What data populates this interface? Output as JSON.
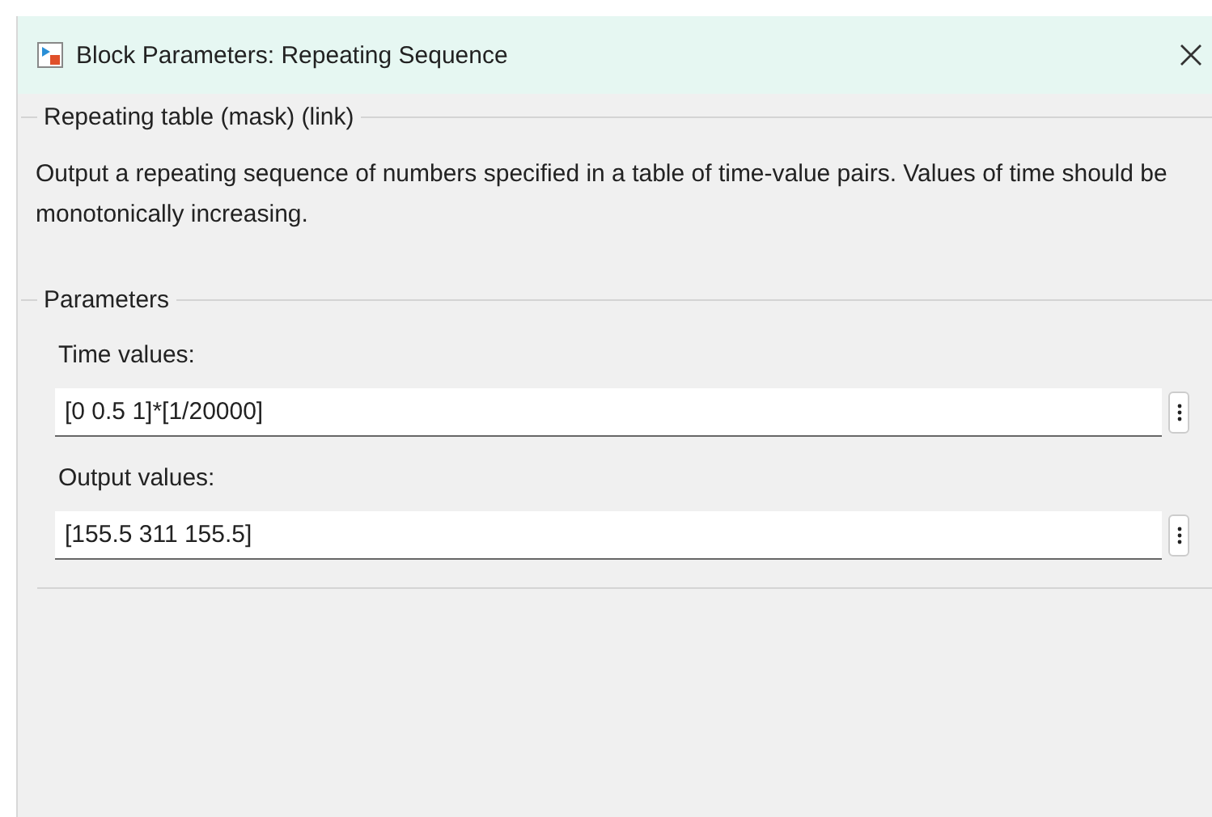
{
  "window": {
    "title": "Block Parameters: Repeating Sequence"
  },
  "description_group": {
    "title": "Repeating table (mask) (link)",
    "text": "Output a repeating sequence of numbers specified in a table of time-value pairs. Values of time should be monotonically increasing."
  },
  "parameters": {
    "title": "Parameters",
    "fields": [
      {
        "label": "Time values:",
        "value": "[0 0.5 1]*[1/20000]"
      },
      {
        "label": "Output values:",
        "value": "[155.5 311 155.5]"
      }
    ]
  }
}
